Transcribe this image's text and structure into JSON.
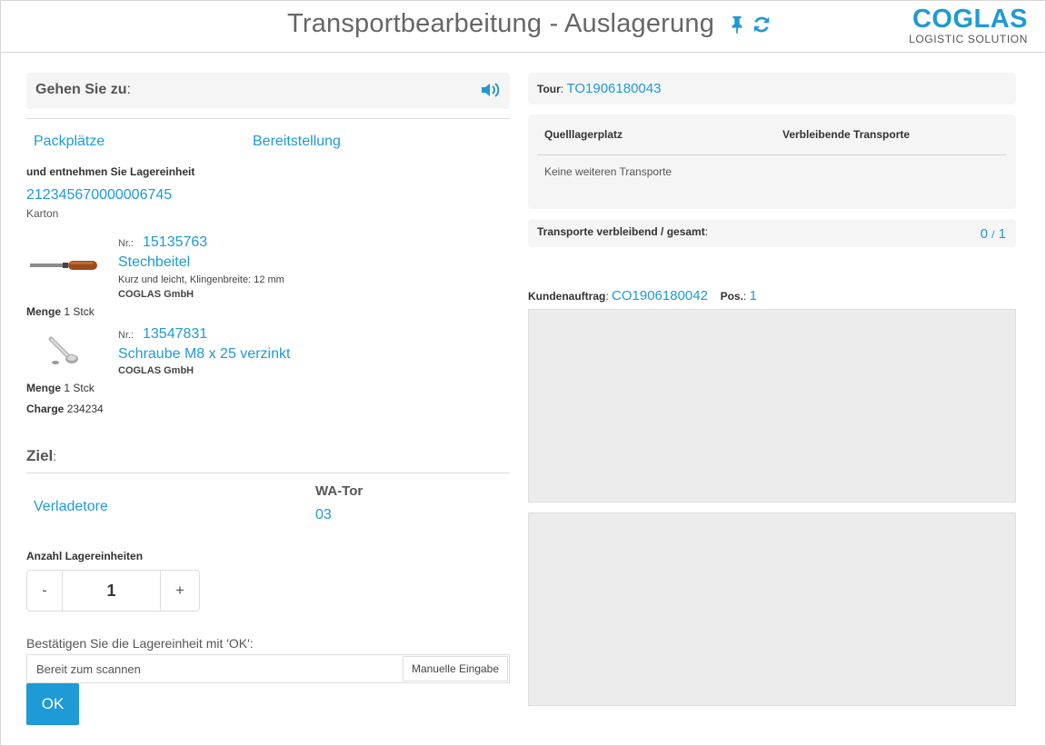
{
  "header": {
    "title": "Transportbearbeitung - Auslagerung",
    "logo_main": "COGLAS",
    "logo_sub": "LOGISTIC SOLUTION"
  },
  "goto": {
    "label": "Gehen Sie zu",
    "link_1": "Packplätze",
    "link_2": "Bereitstellung",
    "take_label": "und entnehmen Sie Lagereinheit",
    "unit_id": "212345670000006745",
    "unit_type": "Karton"
  },
  "items": [
    {
      "nr_label": "Nr.:",
      "nr": "15135763",
      "name": "Stechbeitel",
      "desc": "Kurz und leicht, Klingenbreite: 12 mm",
      "vendor": "COGLAS GmbH",
      "qty_label": "Menge",
      "qty": "1 Stck"
    },
    {
      "nr_label": "Nr.:",
      "nr": "13547831",
      "name": "Schraube M8 x 25 verzinkt",
      "vendor": "COGLAS GmbH",
      "qty_label": "Menge",
      "qty": "1 Stck",
      "batch_label": "Charge",
      "batch": "234234"
    }
  ],
  "target": {
    "label": "Ziel",
    "link": "Verladetore",
    "gate_label": "WA-Tor",
    "gate_value": "03"
  },
  "count": {
    "label": "Anzahl Lagereinheiten",
    "minus": "-",
    "value": "1",
    "plus": "+"
  },
  "confirm": {
    "label": "Bestätigen Sie die Lagereinheit mit 'OK':",
    "placeholder": "Bereit zum scannen",
    "manual_button": "Manuelle Eingabe",
    "ok_button": "OK"
  },
  "tour": {
    "label": "Tour",
    "value": "TO1906180043"
  },
  "transport_table": {
    "col_1": "Quelllagerplatz",
    "col_2": "Verbleibende Transporte",
    "empty": "Keine weiteren Transporte"
  },
  "remaining": {
    "label": "Transporte verbleibend / gesamt",
    "done": "0",
    "sep": "/",
    "total": "1"
  },
  "customer_order": {
    "label": "Kundenauftrag",
    "value": "CO1906180042",
    "pos_label": "Pos.",
    "pos_value": "1"
  },
  "colors": {
    "accent": "#1e9ad6",
    "panel": "#f5f5f5"
  }
}
